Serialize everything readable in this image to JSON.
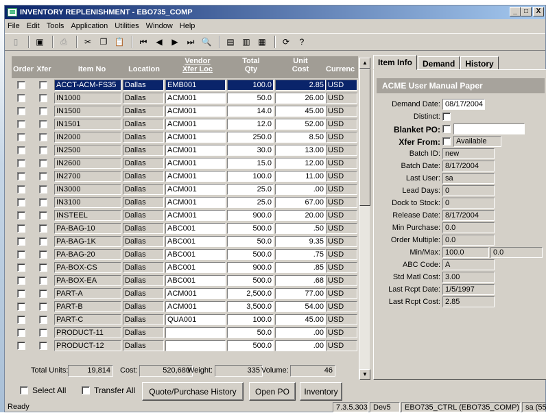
{
  "window": {
    "title": "INVENTORY REPLENISHMENT - EBO735_COMP",
    "buttons": [
      "_",
      "□",
      "X"
    ]
  },
  "menu": [
    {
      "label": "File"
    },
    {
      "label": "Edit"
    },
    {
      "label": "Tools"
    },
    {
      "label": "Application"
    },
    {
      "label": "Utilities"
    },
    {
      "label": "Window"
    },
    {
      "label": "Help"
    }
  ],
  "toolbar_icons": [
    "new-icon",
    "save-icon",
    "print-icon",
    "cut-icon",
    "copy-icon",
    "paste-icon",
    "first-record-icon",
    "previous-record-icon",
    "next-record-icon",
    "last-record-icon",
    "find-icon",
    "properties-icon",
    "new-properties-icon",
    "form-icon",
    "refresh-icon",
    "help-icon"
  ],
  "grid": {
    "headers": {
      "order": "Order",
      "xfer": "Xfer",
      "item_no": "Item No",
      "location": "Location",
      "vendor_line1": "Vendor",
      "vendor_line2": "Xfer Loc",
      "total_line1": "Total",
      "total_line2": "Qty",
      "unit_line1": "Unit",
      "unit_line2": "Cost",
      "currency": "Currenc"
    },
    "rows": [
      {
        "item": "ACCT-ACM-FS35",
        "loc": "Dallas",
        "vendor": "EMB001",
        "qty": "100.0",
        "cost": "2.85",
        "cur": "USD"
      },
      {
        "item": "IN1000",
        "loc": "Dallas",
        "vendor": "ACM001",
        "qty": "50.0",
        "cost": "26.00",
        "cur": "USD"
      },
      {
        "item": "IN1500",
        "loc": "Dallas",
        "vendor": "ACM001",
        "qty": "14.0",
        "cost": "45.00",
        "cur": "USD"
      },
      {
        "item": "IN1501",
        "loc": "Dallas",
        "vendor": "ACM001",
        "qty": "12.0",
        "cost": "52.00",
        "cur": "USD"
      },
      {
        "item": "IN2000",
        "loc": "Dallas",
        "vendor": "ACM001",
        "qty": "250.0",
        "cost": "8.50",
        "cur": "USD"
      },
      {
        "item": "IN2500",
        "loc": "Dallas",
        "vendor": "ACM001",
        "qty": "30.0",
        "cost": "13.00",
        "cur": "USD"
      },
      {
        "item": "IN2600",
        "loc": "Dallas",
        "vendor": "ACM001",
        "qty": "15.0",
        "cost": "12.00",
        "cur": "USD"
      },
      {
        "item": "IN2700",
        "loc": "Dallas",
        "vendor": "ACM001",
        "qty": "100.0",
        "cost": "11.00",
        "cur": "USD"
      },
      {
        "item": "IN3000",
        "loc": "Dallas",
        "vendor": "ACM001",
        "qty": "25.0",
        "cost": ".00",
        "cur": "USD"
      },
      {
        "item": "IN3100",
        "loc": "Dallas",
        "vendor": "ACM001",
        "qty": "25.0",
        "cost": "67.00",
        "cur": "USD"
      },
      {
        "item": "INSTEEL",
        "loc": "Dallas",
        "vendor": "ACM001",
        "qty": "900.0",
        "cost": "20.00",
        "cur": "USD"
      },
      {
        "item": "PA-BAG-10",
        "loc": "Dallas",
        "vendor": "ABC001",
        "qty": "500.0",
        "cost": ".50",
        "cur": "USD"
      },
      {
        "item": "PA-BAG-1K",
        "loc": "Dallas",
        "vendor": "ABC001",
        "qty": "50.0",
        "cost": "9.35",
        "cur": "USD"
      },
      {
        "item": "PA-BAG-20",
        "loc": "Dallas",
        "vendor": "ABC001",
        "qty": "500.0",
        "cost": ".75",
        "cur": "USD"
      },
      {
        "item": "PA-BOX-CS",
        "loc": "Dallas",
        "vendor": "ABC001",
        "qty": "900.0",
        "cost": ".85",
        "cur": "USD"
      },
      {
        "item": "PA-BOX-EA",
        "loc": "Dallas",
        "vendor": "ABC001",
        "qty": "500.0",
        "cost": ".68",
        "cur": "USD"
      },
      {
        "item": "PART-A",
        "loc": "Dallas",
        "vendor": "ACM001",
        "qty": "2,500.0",
        "cost": "77.00",
        "cur": "USD"
      },
      {
        "item": "PART-B",
        "loc": "Dallas",
        "vendor": "ACM001",
        "qty": "3,500.0",
        "cost": "54.00",
        "cur": "USD"
      },
      {
        "item": "PART-C",
        "loc": "Dallas",
        "vendor": "QUA001",
        "qty": "100.0",
        "cost": "45.00",
        "cur": "USD"
      },
      {
        "item": "PRODUCT-11",
        "loc": "Dallas",
        "vendor": "",
        "qty": "50.0",
        "cost": ".00",
        "cur": "USD"
      },
      {
        "item": "PRODUCT-12",
        "loc": "Dallas",
        "vendor": "",
        "qty": "500.0",
        "cost": ".00",
        "cur": "USD"
      }
    ],
    "selected_row": 0
  },
  "totals": {
    "units_label": "Total Units:",
    "units": "19,814",
    "cost_label": "Cost:",
    "cost": "520,680",
    "weight_label": "Weight:",
    "weight": "335",
    "volume_label": "Volume:",
    "volume": "46"
  },
  "bottom": {
    "select_all": "Select All",
    "transfer_all": "Transfer All",
    "quote_button": "Quote/Purchase History",
    "open_po_button": "Open PO",
    "inventory_button": "Inventory"
  },
  "status": {
    "ready": "Ready",
    "version": "7.3.5.303",
    "env": "Dev5",
    "db": "EBO735_CTRL (EBO735_COMP)",
    "user": "sa (55"
  },
  "tabs": [
    {
      "label": "Item Info",
      "active": true
    },
    {
      "label": "Demand",
      "active": false
    },
    {
      "label": "History",
      "active": false
    }
  ],
  "item_info": {
    "title": "ACME User Manual Paper",
    "demand_date_label": "Demand Date:",
    "demand_date": "08/17/2004",
    "distinct_label": "Distinct:",
    "blanket_po_label": "Blanket PO:",
    "xfer_from_label": "Xfer From:",
    "xfer_from_value": "Available",
    "batch_id_label": "Batch ID:",
    "batch_id": "new",
    "batch_date_label": "Batch Date:",
    "batch_date": "8/17/2004",
    "last_user_label": "Last User:",
    "last_user": "sa",
    "lead_days_label": "Lead Days:",
    "lead_days": "0",
    "dock_label": "Dock to Stock:",
    "dock": "0",
    "release_label": "Release Date:",
    "release": "8/17/2004",
    "min_purchase_label": "Min Purchase:",
    "min_purchase": "0.0",
    "order_multiple_label": "Order Multiple:",
    "order_multiple": "0.0",
    "minmax_label": "Min/Max:",
    "min": "100.0",
    "max": "0.0",
    "abc_label": "ABC Code:",
    "abc": "A",
    "std_cost_label": "Std Matl Cost:",
    "std_cost": "3.00",
    "last_rcpt_date_label": "Last Rcpt Date:",
    "last_rcpt_date": "1/5/1997",
    "last_rcpt_cost_label": "Last Rcpt Cost:",
    "last_rcpt_cost": "2.85"
  }
}
